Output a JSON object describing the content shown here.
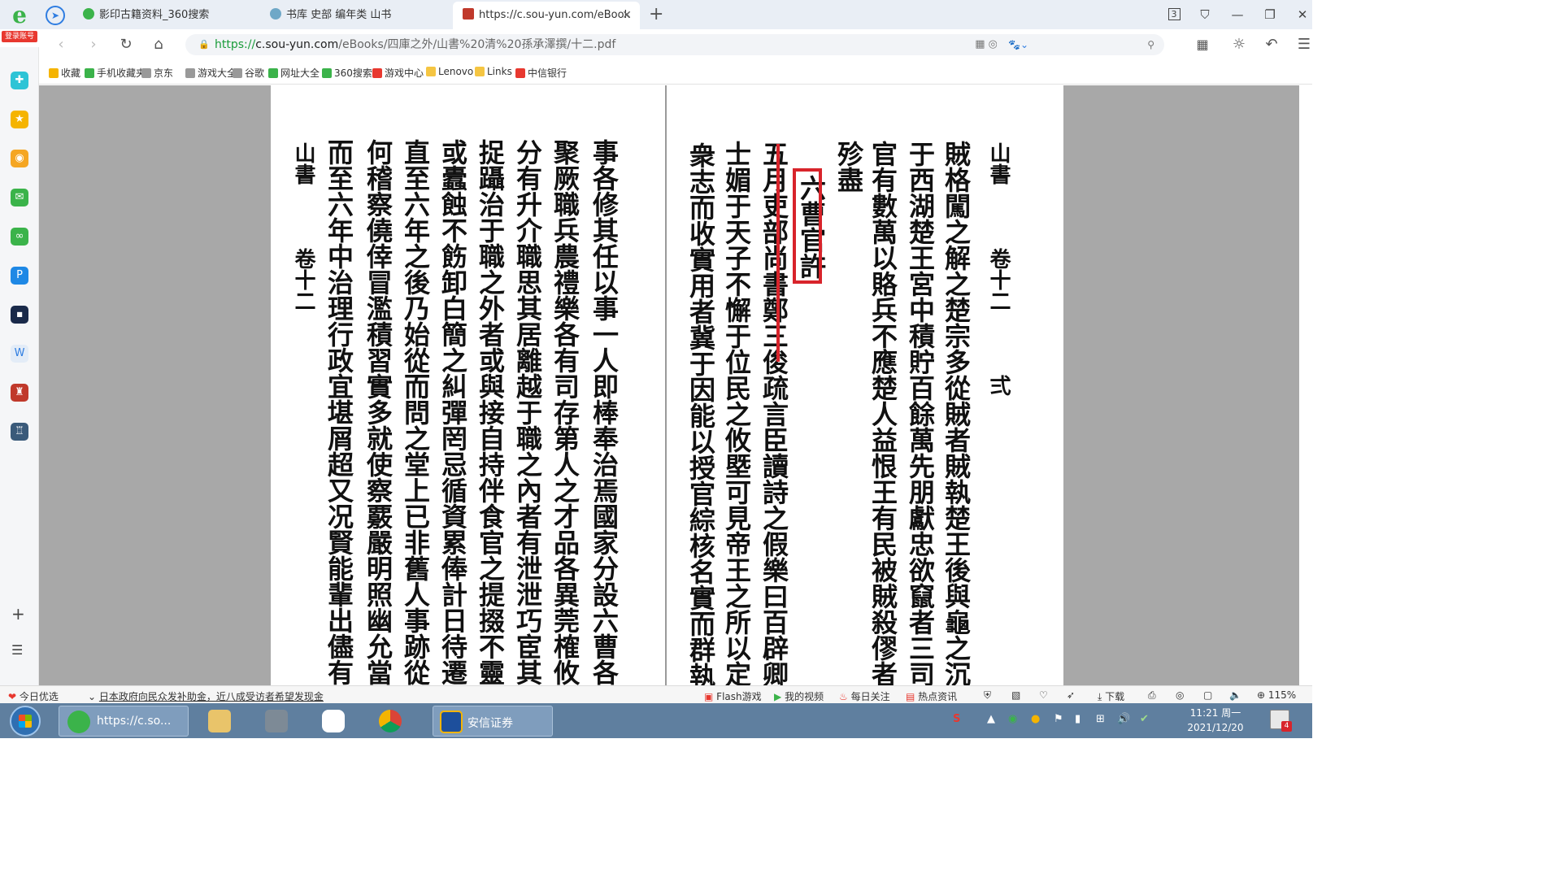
{
  "browser": {
    "login_label": "登录账号",
    "tabs": [
      {
        "title": "影印古籍资料_360搜索",
        "active": false
      },
      {
        "title": "书库 史部 编年类 山书",
        "active": false
      },
      {
        "title": "https://c.sou-yun.com/eBook",
        "active": true
      }
    ],
    "tab_count_badge": "3",
    "new_tab_label": "+",
    "url_scheme": "https://",
    "url_host": "c.sou-yun.com",
    "url_path": "/eBooks/四庫之外/山書%20清%20孫承澤撰/十二.pdf"
  },
  "bookmarks": [
    {
      "label": "收藏",
      "color": "#f5b400"
    },
    {
      "label": "手机收藏夹",
      "color": "#3bb34a"
    },
    {
      "label": "京东",
      "color": "#999999"
    },
    {
      "label": "游戏大全",
      "color": "#999999"
    },
    {
      "label": "谷歌",
      "color": "#999999"
    },
    {
      "label": "网址大全",
      "color": "#3bb34a"
    },
    {
      "label": "360搜索",
      "color": "#3bb34a"
    },
    {
      "label": "游戏中心",
      "color": "#e8382f"
    },
    {
      "label": "Lenovo",
      "color": "#f5c542"
    },
    {
      "label": "Links",
      "color": "#f5c542"
    },
    {
      "label": "中信银行",
      "color": "#e8382f"
    }
  ],
  "document": {
    "left_page_columns": [
      "山書　　　卷十二",
      "而至六年中治理行政宜堪屑超又况賢能輩出儘有",
      "何稽察僥倖冒濫積習實多就使察覈嚴明照幽允當",
      "直至六年之後乃始從而問之堂上已非舊人事跡從",
      "或蠹蝕不飭卸白簡之糾彈罔忌循資累俸計日待遷",
      "捉躡治于職之外者或與接自持伴食官之提掇不靈",
      "分有升介職思其居離越于職之內者有泄泄巧宦其",
      "聚厥職兵農禮樂各有司存第人之才品各異莞榷攸",
      "事各修其任以事一人即棒奉治焉國家分設六曹各"
    ],
    "right_page_columns": [
      "衆志而收實用者冀于因能以授官綜核名實而群執",
      "士媚于天子不懈于位民之攸塈可見帝王之所以定",
      "五月吏部尚書鄭三俊疏言臣讀詩之假樂曰百辟卿",
      "六曹官許",
      "殄盡",
      "官有數萬以賂兵不應楚人益恨王有民被賊殺僇者",
      "于西湖楚王宮中積貯百餘萬先朋獻忠欲竄者三司",
      "賊格闖之解之楚宗多從賊者賊執楚王後與龜之沉",
      "山書　　　卷十二　　　弍"
    ]
  },
  "statusbar": {
    "today_label": "今日优选",
    "news": "日本政府向民众发补助金，近八成受访者希望发现金",
    "flash": "Flash游戏",
    "video": "我的视频",
    "daily": "每日关注",
    "hot": "热点资讯",
    "download": "下载",
    "zoom": "115%"
  },
  "taskbar": {
    "browser_item": "https://c.so...",
    "app_item": "安信证券",
    "time": "11:21 周一",
    "date": "2021/12/20",
    "notif_count": "4"
  }
}
